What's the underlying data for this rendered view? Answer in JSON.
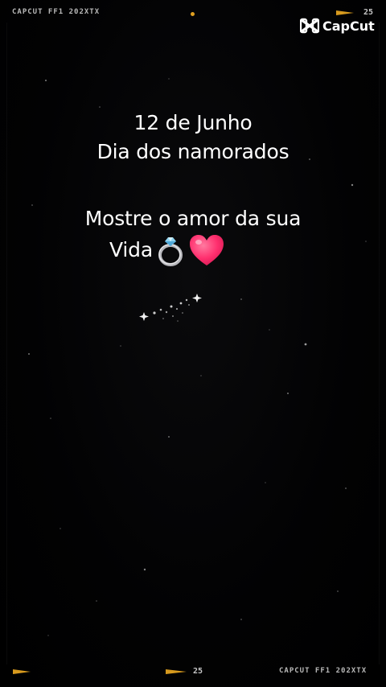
{
  "film_strip": {
    "top_left_label": "CAPCUT  FF1 202XTX",
    "top_right_number": "25",
    "bottom_number": "25",
    "bottom_right_label": "CAPCUT  FF1 202XTX"
  },
  "watermark": {
    "label": "CapCut",
    "icon": "capcut-logo-icon"
  },
  "message": {
    "date": "12 de Junho",
    "occasion": "Dia dos namorados",
    "call_to_action": "Mostre o amor da sua",
    "last_word": "Vida",
    "emojis": [
      "ring-icon",
      "heart-icon"
    ]
  },
  "colors": {
    "background": "#000000",
    "film_accent": "#d79a1e",
    "text": "#ffffff",
    "heart": "#ff2f6e"
  }
}
